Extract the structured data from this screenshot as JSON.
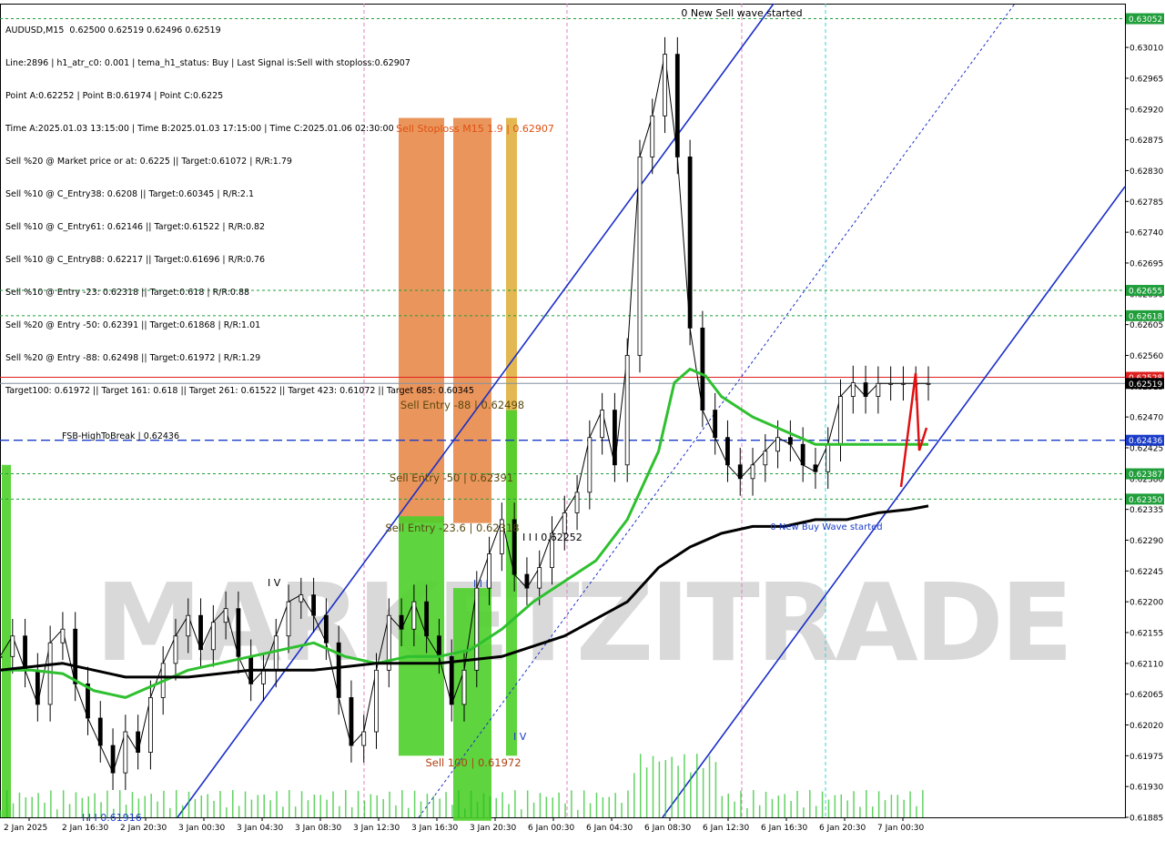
{
  "info": {
    "lines": [
      "AUDUSD,M15  0.62500 0.62519 0.62496 0.62519",
      "Line:2896 | h1_atr_c0: 0.001 | tema_h1_status: Buy | Last Signal is:Sell with stoploss:0.62907",
      "Point A:0.62252 | Point B:0.61974 | Point C:0.6225",
      "Time A:2025.01.03 13:15:00 | Time B:2025.01.03 17:15:00 | Time C:2025.01.06 02:30:00",
      "Sell %20 @ Market price or at: 0.6225 || Target:0.61072 | R/R:1.79",
      "Sell %10 @ C_Entry38: 0.6208 || Target:0.60345 | R/R:2.1",
      "Sell %10 @ C_Entry61: 0.62146 || Target:0.61522 | R/R:0.82",
      "Sell %10 @ C_Entry88: 0.62217 || Target:0.61696 | R/R:0.76",
      "Sell %10 @ Entry -23: 0.62318 || Target:0.618 | R/R:0.88",
      "Sell %20 @ Entry -50: 0.62391 || Target:0.61868 | R/R:1.01",
      "Sell %20 @ Entry -88: 0.62498 || Target:0.61972 | R/R:1.29",
      "Target100: 0.61972 || Target 161: 0.618 || Target 261: 0.61522 || Target 423: 0.61072 || Target 685: 0.60345"
    ]
  },
  "chart_data": {
    "type": "line",
    "symbol": "AUDUSD",
    "timeframe": "M15",
    "watermark": "MARKETZITRADE",
    "ylim": [
      0.61885,
      0.63074
    ],
    "y_ticks": [
      "0.63010",
      "0.62965",
      "0.62920",
      "0.62875",
      "0.62830",
      "0.62785",
      "0.62740",
      "0.62695",
      "0.62650",
      "0.62605",
      "0.62560",
      "0.62515",
      "0.62470",
      "0.62425",
      "0.62380",
      "0.62335",
      "0.62290",
      "0.62245",
      "0.62200",
      "0.62155",
      "0.62110",
      "0.62065",
      "0.62020",
      "0.61975",
      "0.61930",
      "0.61885"
    ],
    "x_ticks": [
      "2 Jan 2025",
      "2 Jan 16:30",
      "2 Jan 20:30",
      "3 Jan 00:30",
      "3 Jan 04:30",
      "3 Jan 08:30",
      "3 Jan 12:30",
      "3 Jan 16:30",
      "3 Jan 20:30",
      "6 Jan 00:30",
      "6 Jan 04:30",
      "6 Jan 08:30",
      "6 Jan 12:30",
      "6 Jan 16:30",
      "6 Jan 20:30",
      "7 Jan 00:30"
    ],
    "price_badges": [
      {
        "value": "0.63052",
        "price": 0.63052,
        "color": "#1f9e3a"
      },
      {
        "value": "0.62655",
        "price": 0.62655,
        "color": "#1f9e3a"
      },
      {
        "value": "0.62618",
        "price": 0.62618,
        "color": "#1f9e3a"
      },
      {
        "value": "0.62528",
        "price": 0.62528,
        "color": "#e02020"
      },
      {
        "value": "0.62519",
        "price": 0.62519,
        "color": "#000000"
      },
      {
        "value": "0.62436",
        "price": 0.62436,
        "color": "#1a3cc8"
      },
      {
        "value": "0.62387",
        "price": 0.62387,
        "color": "#1f9e3a"
      },
      {
        "value": "0.62350",
        "price": 0.6235,
        "color": "#1f9e3a"
      }
    ],
    "levels": [
      {
        "price": 0.63052,
        "color": "#1f9e3a",
        "style": "dotted"
      },
      {
        "price": 0.62655,
        "color": "#1f9e3a",
        "style": "dotted"
      },
      {
        "price": 0.62618,
        "color": "#1f9e3a",
        "style": "dotted"
      },
      {
        "price": 0.62528,
        "color": "#e02020",
        "style": "solid"
      },
      {
        "price": 0.62519,
        "color": "#8090a0",
        "style": "solid"
      },
      {
        "price": 0.62436,
        "color": "#1a3cc8",
        "style": "dashed"
      },
      {
        "price": 0.62387,
        "color": "#1f9e3a",
        "style": "dotted"
      },
      {
        "price": 0.6235,
        "color": "#1f9e3a",
        "style": "dotted"
      }
    ],
    "annotations": [
      {
        "text": "0 New Sell wave started",
        "color": "#000000"
      },
      {
        "text": "Sell Stoploss M15 1.9 | 0.62907",
        "color": "#e05010"
      },
      {
        "text": "Sell Entry -88 | 0.62498",
        "color": "#5a4a10"
      },
      {
        "text": "Sell Entry -50 | 0.62391",
        "color": "#5a4a10"
      },
      {
        "text": "Sell Entry -23.6 | 0.62318",
        "color": "#5a4a10"
      },
      {
        "text": "Sell 100 | 0.61972",
        "color": "#b04010"
      },
      {
        "text": "FSB-HighToBreak | 0.62436",
        "color": "#000000"
      },
      {
        "text": "0 New Buy Wave started",
        "color": "#1a3cc8"
      },
      {
        "text": "I I I 0.62252",
        "color": "#000000"
      },
      {
        "text": "I I I 0.61916",
        "color": "#1a3cc8"
      },
      {
        "text": "I V",
        "color": "#000000"
      },
      {
        "text": "I V",
        "color": "#1a3cc8"
      },
      {
        "text": "I I I",
        "color": "#1a3cc8"
      }
    ],
    "series": [
      {
        "name": "price",
        "color": "#000000",
        "x": [
          0,
          4,
          8,
          12,
          16,
          20,
          24,
          28,
          32,
          36,
          40,
          44,
          48,
          52,
          56,
          60,
          64,
          68,
          72,
          76,
          80,
          84,
          88,
          92,
          96,
          100,
          104,
          108,
          112,
          116,
          120,
          124,
          128,
          132,
          136,
          140,
          144,
          148,
          152,
          156,
          160,
          164,
          168,
          172,
          176,
          180,
          184,
          188,
          192,
          196,
          200,
          204,
          208,
          212,
          216,
          220,
          224,
          228,
          232,
          236,
          240,
          244,
          248,
          252,
          256,
          260,
          264,
          268,
          272,
          276,
          280,
          284,
          288,
          292,
          296
        ],
        "values": [
          0.6212,
          0.6215,
          0.621,
          0.6205,
          0.6214,
          0.6216,
          0.6208,
          0.6203,
          0.6199,
          0.6195,
          0.6201,
          0.6198,
          0.6206,
          0.6211,
          0.6215,
          0.6218,
          0.6213,
          0.6217,
          0.6219,
          0.6212,
          0.6208,
          0.621,
          0.6215,
          0.622,
          0.6221,
          0.6218,
          0.6214,
          0.6206,
          0.6199,
          0.6201,
          0.621,
          0.6218,
          0.6216,
          0.622,
          0.6215,
          0.6212,
          0.6205,
          0.621,
          0.6222,
          0.6227,
          0.6232,
          0.6224,
          0.6222,
          0.6225,
          0.623,
          0.6233,
          0.6236,
          0.6244,
          0.6248,
          0.624,
          0.6256,
          0.6285,
          0.6291,
          0.63,
          0.6285,
          0.626,
          0.6248,
          0.6244,
          0.624,
          0.6238,
          0.624,
          0.6242,
          0.6244,
          0.6243,
          0.624,
          0.6239,
          0.6243,
          0.625,
          0.6252,
          0.625,
          0.62519,
          0.62519,
          0.62519,
          0.62519,
          0.62519
        ]
      },
      {
        "name": "ma_green",
        "color": "#2ec02e",
        "x": [
          0,
          10,
          20,
          30,
          40,
          50,
          60,
          70,
          80,
          90,
          100,
          110,
          120,
          130,
          140,
          150,
          160,
          170,
          180,
          190,
          200,
          210,
          215,
          220,
          225,
          230,
          240,
          250,
          260,
          270,
          280,
          290,
          296
        ],
        "values": [
          0.621,
          0.621,
          0.62095,
          0.6207,
          0.6206,
          0.6208,
          0.621,
          0.6211,
          0.6212,
          0.6213,
          0.6214,
          0.6212,
          0.6211,
          0.6212,
          0.6212,
          0.6213,
          0.6216,
          0.622,
          0.6223,
          0.6226,
          0.6232,
          0.6242,
          0.6252,
          0.6254,
          0.6253,
          0.625,
          0.6247,
          0.6245,
          0.6243,
          0.6243,
          0.6243,
          0.6243,
          0.6243
        ]
      },
      {
        "name": "ma_black",
        "color": "#000000",
        "x": [
          0,
          20,
          40,
          60,
          80,
          100,
          120,
          140,
          160,
          180,
          200,
          210,
          220,
          230,
          240,
          250,
          260,
          270,
          280,
          290,
          296
        ],
        "values": [
          0.621,
          0.6211,
          0.6209,
          0.6209,
          0.621,
          0.621,
          0.6211,
          0.6211,
          0.6212,
          0.6215,
          0.622,
          0.6225,
          0.6228,
          0.623,
          0.6231,
          0.6231,
          0.6232,
          0.6232,
          0.6233,
          0.62335,
          0.6234
        ]
      }
    ]
  }
}
